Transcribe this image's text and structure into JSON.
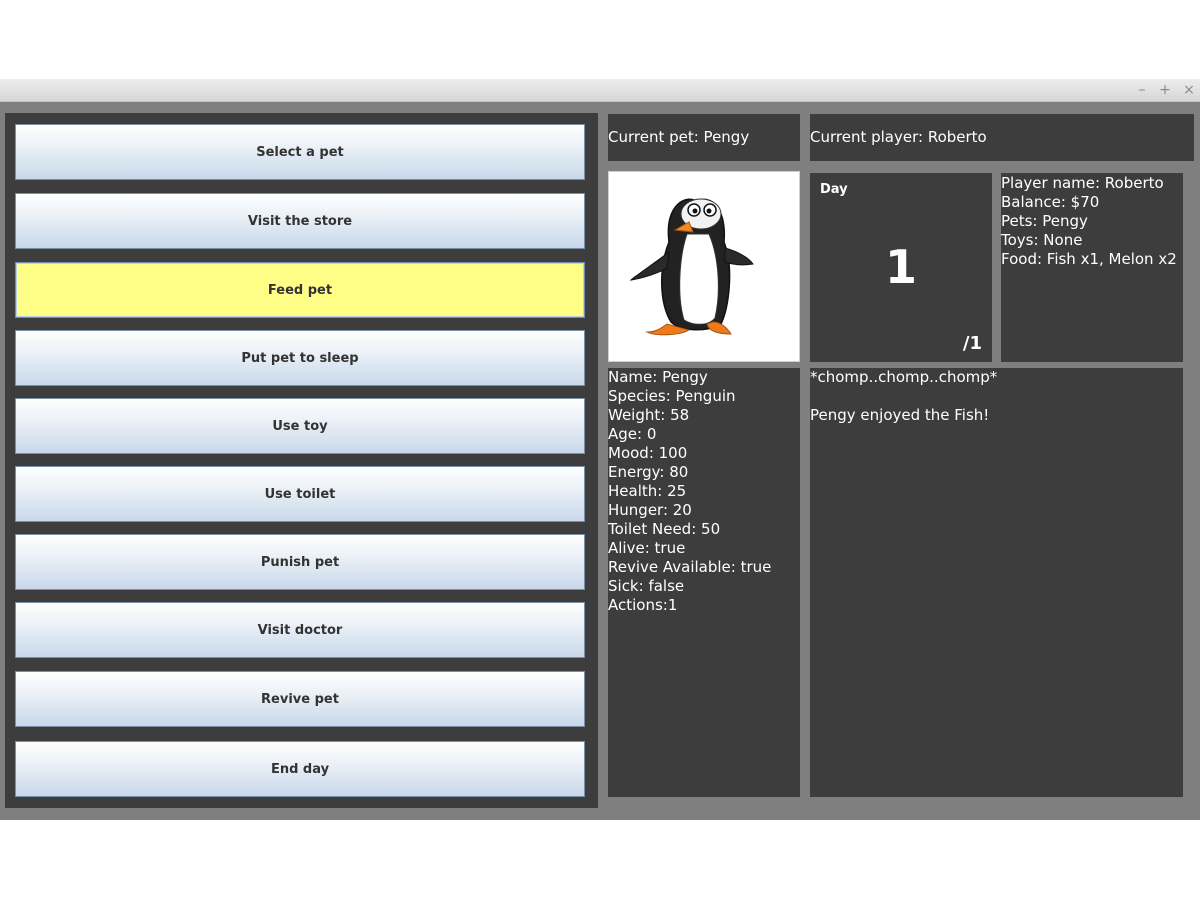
{
  "window": {
    "controls": {
      "minimize": "–",
      "maximize": "+",
      "close": "×"
    }
  },
  "actions": [
    {
      "label": "Select a pet",
      "selected": false
    },
    {
      "label": "Visit the store",
      "selected": false
    },
    {
      "label": "Feed pet",
      "selected": true
    },
    {
      "label": "Put pet to sleep",
      "selected": false
    },
    {
      "label": "Use toy",
      "selected": false
    },
    {
      "label": "Use toilet",
      "selected": false
    },
    {
      "label": "Punish pet",
      "selected": false
    },
    {
      "label": "Visit doctor",
      "selected": false
    },
    {
      "label": "Revive pet",
      "selected": false
    },
    {
      "label": "End day",
      "selected": false
    }
  ],
  "current_pet": "Current pet: Pengy",
  "current_player": "Current player: Roberto",
  "pet_image": {
    "icon": "penguin-image"
  },
  "day": {
    "label": "Day",
    "number": "1",
    "total": "/1"
  },
  "player_info": [
    "Player name: Roberto",
    "Balance: $70",
    "Pets: Pengy",
    "Toys: None",
    "Food: Fish x1, Melon x2"
  ],
  "pet_stats": [
    "Name: Pengy",
    "Species: Penguin",
    "Weight: 58",
    "Age: 0",
    "Mood: 100",
    "Energy: 80",
    "Health: 25",
    "Hunger: 20",
    "Toilet Need: 50",
    "Alive: true",
    "Revive Available: true",
    "Sick: false",
    "Actions:1"
  ],
  "log": [
    "*chomp..chomp..chomp*",
    "",
    "Pengy enjoyed the Fish!"
  ],
  "colors": {
    "panel_bg": "#3d3d3d",
    "window_bg": "#7f7f7f",
    "selected_button": "#ffff88"
  }
}
